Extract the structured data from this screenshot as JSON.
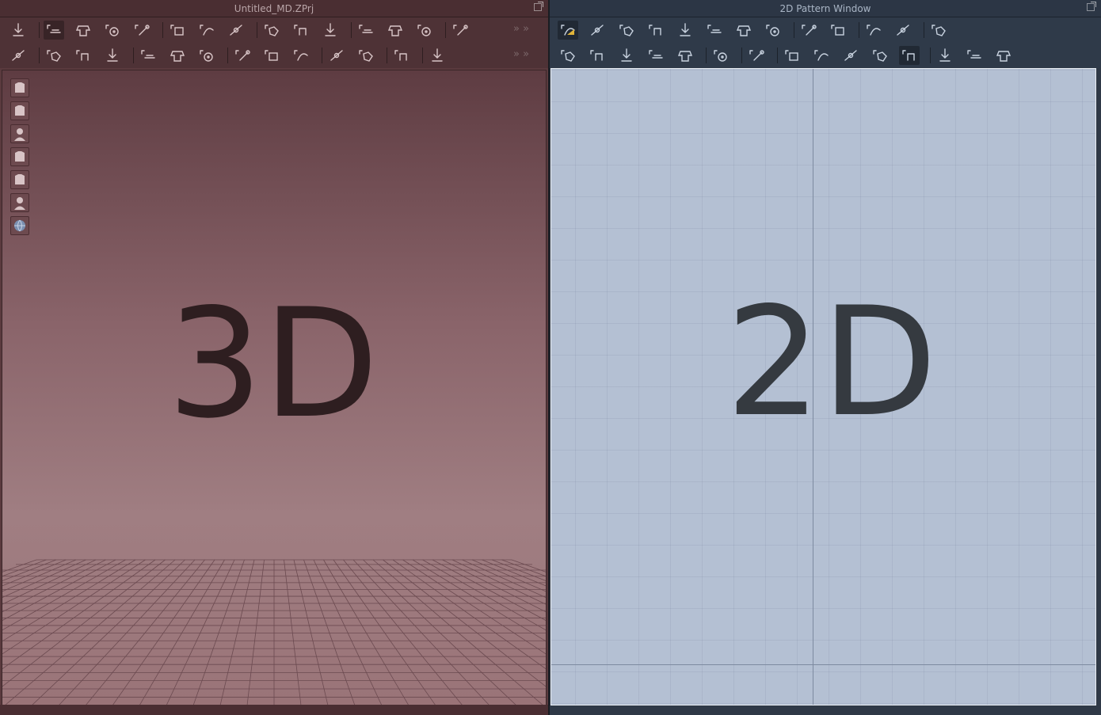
{
  "left_window": {
    "title": "Untitled_MD.ZPrj",
    "viewport_label": "3D",
    "background_top": "#5e3c42",
    "background_bottom": "#a07e82"
  },
  "right_window": {
    "title": "2D Pattern Window",
    "viewport_label": "2D",
    "background": "#b4c0d3"
  },
  "left_toolbar_row1": [
    "simulation-icon",
    "transform-icon",
    "edit-texture-icon",
    "transform-pattern-icon",
    "fold-arrangement-icon",
    "segment-sewing-icon",
    "free-sewing-icon",
    "m-n-sewing-icon",
    "tack-icon",
    "tack-on-avatar-icon",
    "select-mesh-icon",
    "fitting-icon",
    "strengthen-icon",
    "garment-fit-icon",
    "show-pattern-icon"
  ],
  "left_toolbar_row2": [
    "select-pin-icon",
    "pin-icon",
    "brush-icon",
    "edit-pin-icon",
    "reset-icon",
    "stitch-icon",
    "zipper-icon",
    "button-icon",
    "buttonhole-icon",
    "select-button-icon",
    "measure-icon",
    "ruler-icon",
    "topstitch-icon",
    "trim-icon"
  ],
  "right_toolbar_row1": [
    "transform-pattern-2d-icon",
    "edit-point-icon",
    "edit-curvature-icon",
    "curve-point-icon",
    "add-point-icon",
    "polygon-icon",
    "rectangle-icon",
    "internal-polygon-icon",
    "dart-icon",
    "fold-icon",
    "pleat-icon",
    "grade-icon",
    "layout-icon"
  ],
  "right_toolbar_row2": [
    "segment-sewing-2d-icon",
    "free-sewing-2d-icon",
    "m-n-sewing-2d-icon",
    "check-sewing-icon",
    "edit-sewing-icon",
    "fold-arrangement-2d-icon",
    "fabric-icon",
    "fit-icon",
    "texture-icon",
    "uv-icon",
    "graphic-icon",
    "topstitch-2d-icon",
    "seamline-icon",
    "binding-icon",
    "elastic-icon"
  ],
  "side_tools": [
    "garment-icon",
    "avatar-outfit-icon",
    "avatar-icon",
    "fabric-view-icon",
    "texture-view-icon",
    "head-avatar-icon",
    "globe-icon"
  ]
}
